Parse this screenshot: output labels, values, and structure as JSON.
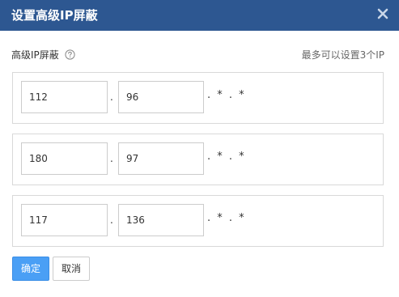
{
  "dialog": {
    "title": "设置高级IP屏蔽",
    "close_icon": "close-icon"
  },
  "section": {
    "label": "高级IP屏蔽",
    "help_icon": "question-circle-icon",
    "limit_note": "最多可以设置3个IP"
  },
  "ip_rules": [
    {
      "octet1": "112",
      "octet2": "96",
      "separator": ".",
      "wildcard": ". * . *"
    },
    {
      "octet1": "180",
      "octet2": "97",
      "separator": ".",
      "wildcard": ". * . *"
    },
    {
      "octet1": "117",
      "octet2": "136",
      "separator": ".",
      "wildcard": ". * . *"
    }
  ],
  "buttons": {
    "confirm_label": "确定",
    "cancel_label": "取消"
  },
  "colors": {
    "titlebar": "#2d5791",
    "primary_button": "#4a9ff5"
  }
}
